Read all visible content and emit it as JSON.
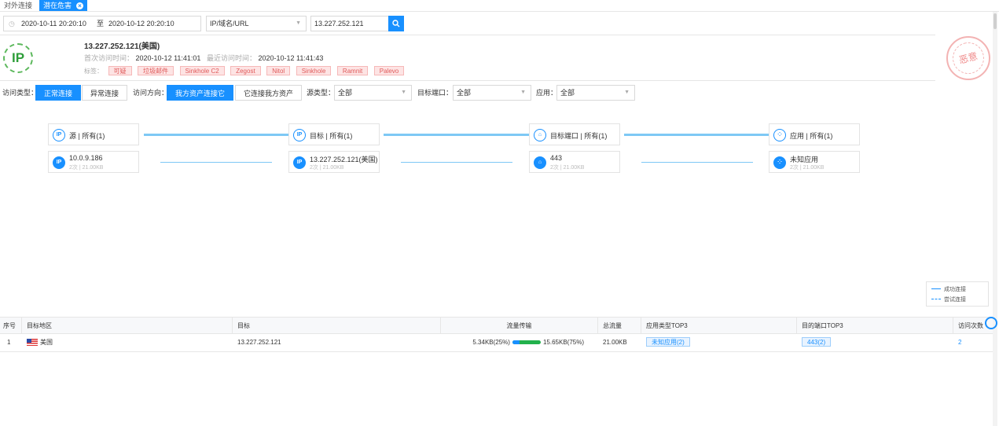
{
  "tabs": [
    {
      "label": "对外连接",
      "active": false
    },
    {
      "label": "潜在危害",
      "active": true
    }
  ],
  "filters": {
    "time_start": "2020-10-11 20:20:10",
    "time_sep": "至",
    "time_end": "2020-10-12 20:20:10",
    "type_select": "IP/域名/URL",
    "search_value": "13.227.252.121"
  },
  "ip_info": {
    "logo_text": "IP",
    "ip": "13.227.252.121(美国)",
    "first_label": "首次访问时间：",
    "first_time": "2020-10-12 11:41:01",
    "last_label": "最近访问时间：",
    "last_time": "2020-10-12 11:41:43",
    "tags_label": "标签：",
    "tags": [
      "可疑",
      "垃圾邮件",
      "Sinkhole C2",
      "Zegost",
      "Nitol",
      "Sinkhole",
      "Ramnit",
      "Palevo"
    ],
    "stamp": "恶意"
  },
  "options": {
    "visit_type_label": "访问类型：",
    "visit_types": [
      "正常连接",
      "异常连接"
    ],
    "visit_type_selected": "正常连接",
    "direction_label": "访问方向：",
    "directions": [
      "我方资产连接它",
      "它连接我方资产"
    ],
    "direction_selected": "我方资产连接它",
    "source_type_label": "源类型：",
    "source_type_value": "全部",
    "target_port_label": "目标端口：",
    "target_port_value": "全部",
    "app_label": "应用：",
    "app_value": "全部"
  },
  "flow": {
    "headers": [
      "源 | 所有(1)",
      "目标 | 所有(1)",
      "目标端口 | 所有(1)",
      "应用 | 所有(1)"
    ],
    "nodes": [
      {
        "title": "10.0.9.186",
        "sub": "2次 | 21.00KB",
        "icon": "ip-icon"
      },
      {
        "title": "13.227.252.121(美国)",
        "sub": "2次 | 21.00KB",
        "icon": "ip-icon"
      },
      {
        "title": "443",
        "sub": "2次 | 21.00KB",
        "icon": "bank-icon"
      },
      {
        "title": "未知应用",
        "sub": "2次 | 21.00KB",
        "icon": "grid-icon"
      }
    ]
  },
  "legend": {
    "success": "成功连接",
    "attempt": "尝试连接"
  },
  "table": {
    "columns": [
      "序号",
      "目标地区",
      "目标",
      "流量传输",
      "总流量",
      "应用类型TOP3",
      "目的端口TOP3",
      "访问次数"
    ],
    "rows": [
      {
        "index": "1",
        "region": "美国",
        "target": "13.227.252.121",
        "up": "5.34KB(25%)",
        "down": "15.65KB(75%)",
        "up_pct": 25,
        "total": "21.00KB",
        "app": "未知应用(2)",
        "port": "443(2)",
        "count": "2"
      }
    ]
  },
  "colors": {
    "accent": "#1890ff",
    "danger": "#e05a5a",
    "success": "#22b14c"
  }
}
